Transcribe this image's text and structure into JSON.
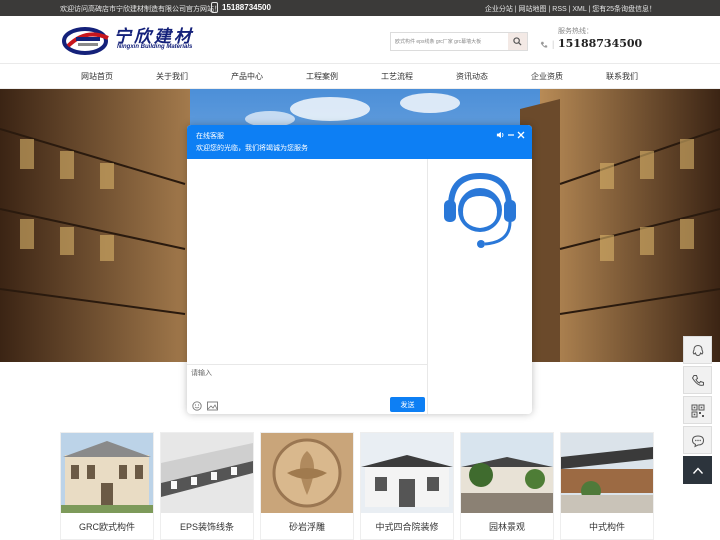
{
  "topbar": {
    "welcome": "欢迎访问高碑店市宁欣建材制造有限公司官方网站！",
    "phone": "15188734500",
    "links": "企业分站 | 网站地图 | RSS | XML | 您有25条询盘信息！"
  },
  "header": {
    "logo_cn": "宁欣建材",
    "logo_en": "Ningxin Building Materials",
    "search_placeholder": "欧式构件 eps线条 grc厂家 grc幕墙大板",
    "hotline_label": "服务热线：",
    "hotline_number": "15188734500"
  },
  "nav": [
    {
      "label": "网站首页"
    },
    {
      "label": "关于我们"
    },
    {
      "label": "产品中心"
    },
    {
      "label": "工程案例"
    },
    {
      "label": "工艺流程"
    },
    {
      "label": "资讯动态"
    },
    {
      "label": "企业资质"
    },
    {
      "label": "联系我们"
    }
  ],
  "products": [
    {
      "label": "GRC欧式构件"
    },
    {
      "label": "EPS装饰线条"
    },
    {
      "label": "砂岩浮雕"
    },
    {
      "label": "中式四合院装修"
    },
    {
      "label": "园林景观"
    },
    {
      "label": "中式构件"
    }
  ],
  "chat": {
    "title": "在线客服",
    "welcome": "欢迎您的光临，我们将竭诚为您服务",
    "input_placeholder": "请输入",
    "send_label": "发送"
  },
  "icons": {
    "volume": "volume-icon",
    "minimize": "minimize-icon",
    "close": "close-icon",
    "agent": "customer-service-headset-icon",
    "emoji": "emoji-icon",
    "image": "image-icon",
    "qq": "qq-icon",
    "phone": "phone-icon",
    "qrcode": "qrcode-icon",
    "message": "message-icon",
    "back_to_top": "back-to-top-icon"
  },
  "colors": {
    "chat_blue": "#0d7ff4",
    "topbar_bg": "#3b3a39",
    "logo_navy": "#14217a"
  }
}
